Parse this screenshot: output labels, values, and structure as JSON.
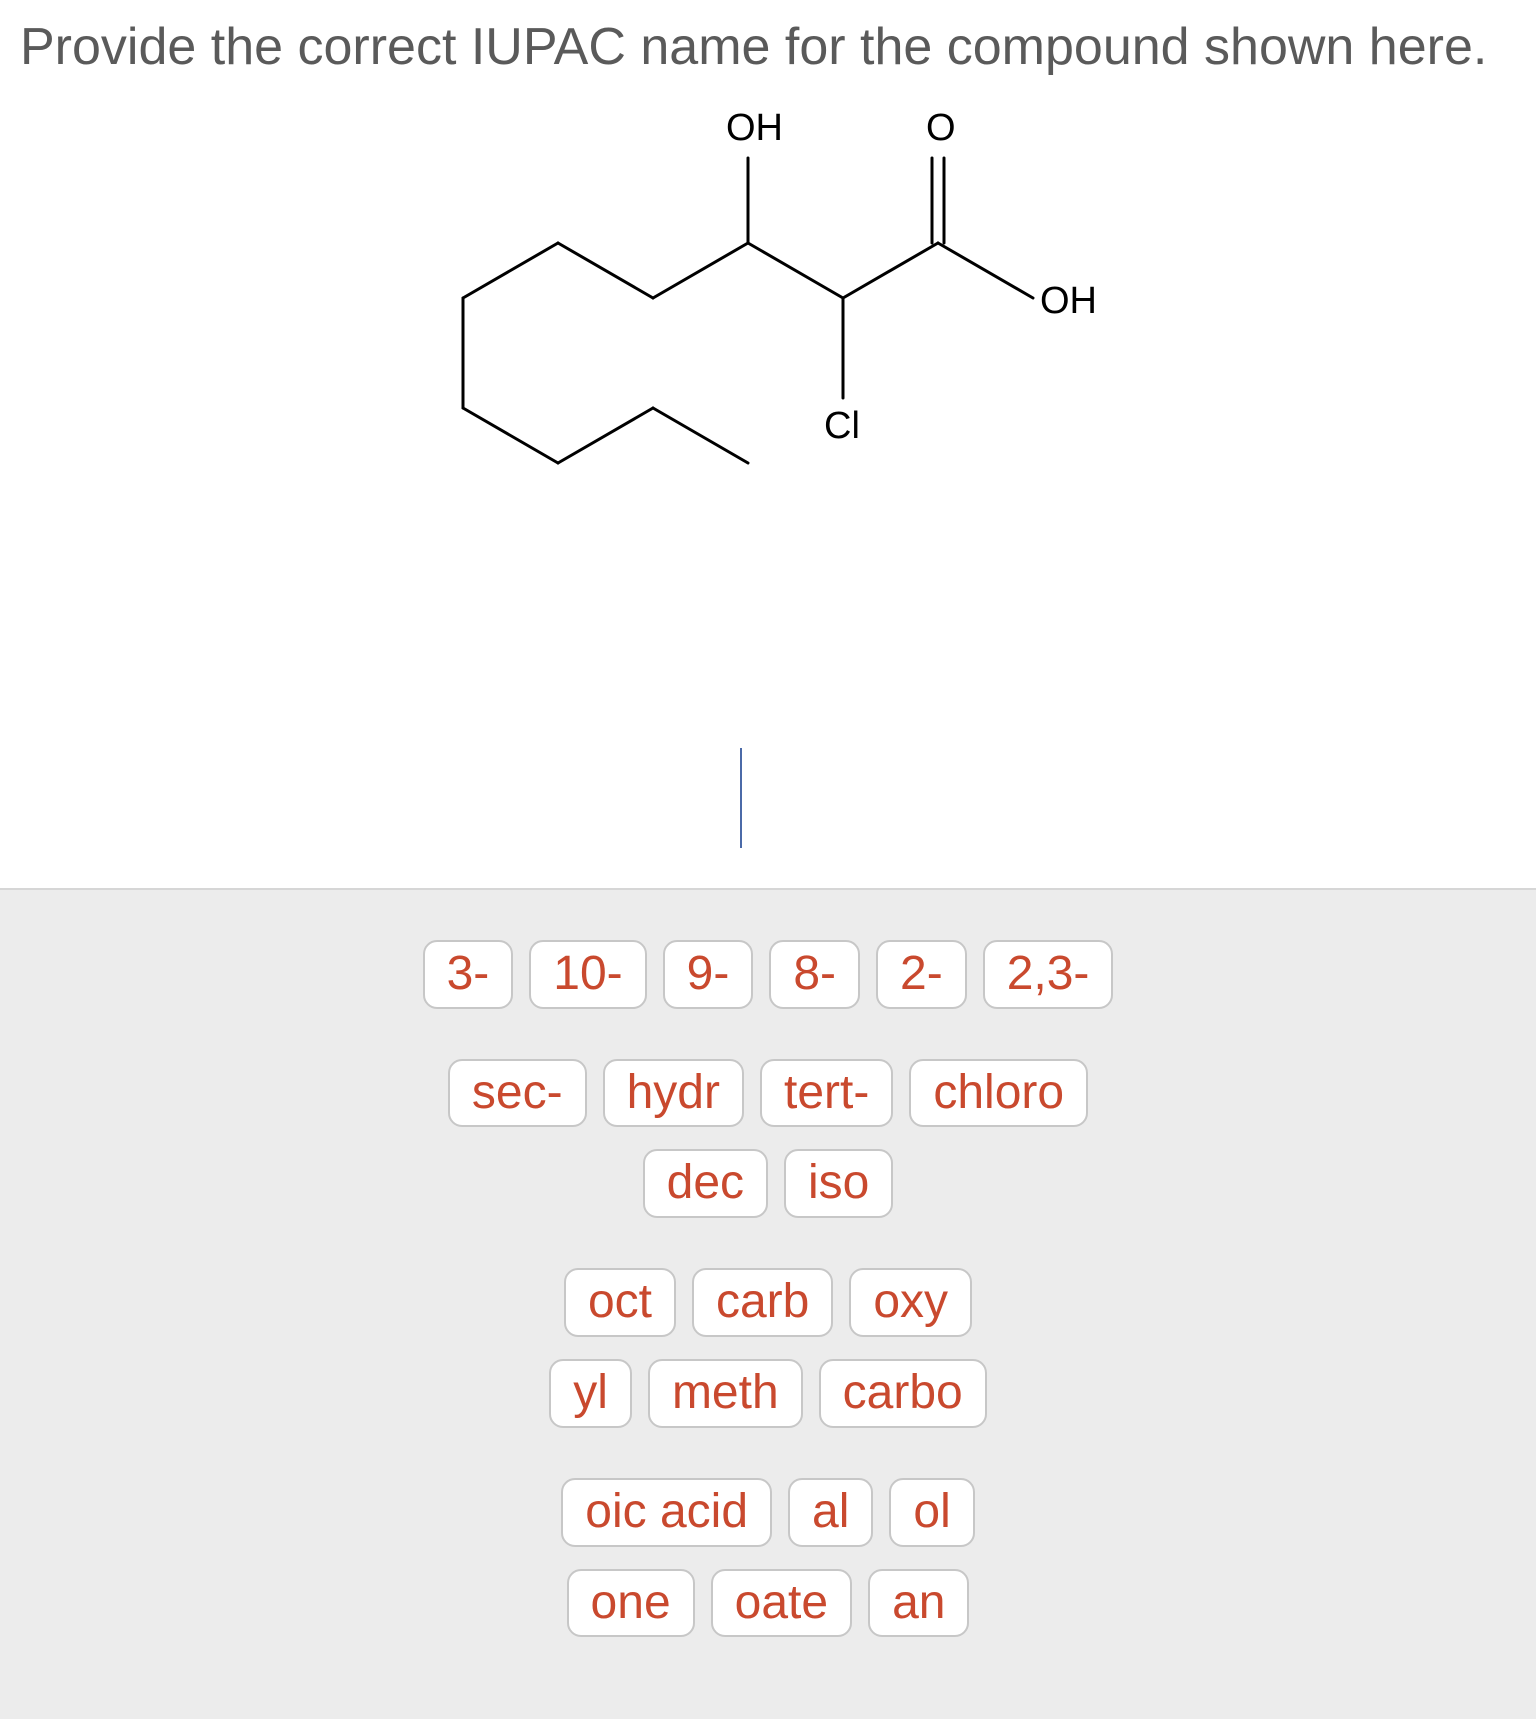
{
  "prompt": "Provide the correct IUPAC name for the compound shown here.",
  "structure_labels": {
    "oh_top": "OH",
    "o_double": "O",
    "oh_right": "OH",
    "cl": "Cl"
  },
  "tile_groups": [
    [
      [
        "3-",
        "10-",
        "9-",
        "8-",
        "2-",
        "2,3-"
      ]
    ],
    [
      [
        "sec-",
        "hydr",
        "tert-",
        "chloro"
      ],
      [
        "dec",
        "iso"
      ]
    ],
    [
      [
        "oct",
        "carb",
        "oxy"
      ],
      [
        "yl",
        "meth",
        "carbo"
      ]
    ],
    [
      [
        "oic acid",
        "al",
        "ol"
      ],
      [
        "one",
        "oate",
        "an"
      ]
    ]
  ]
}
